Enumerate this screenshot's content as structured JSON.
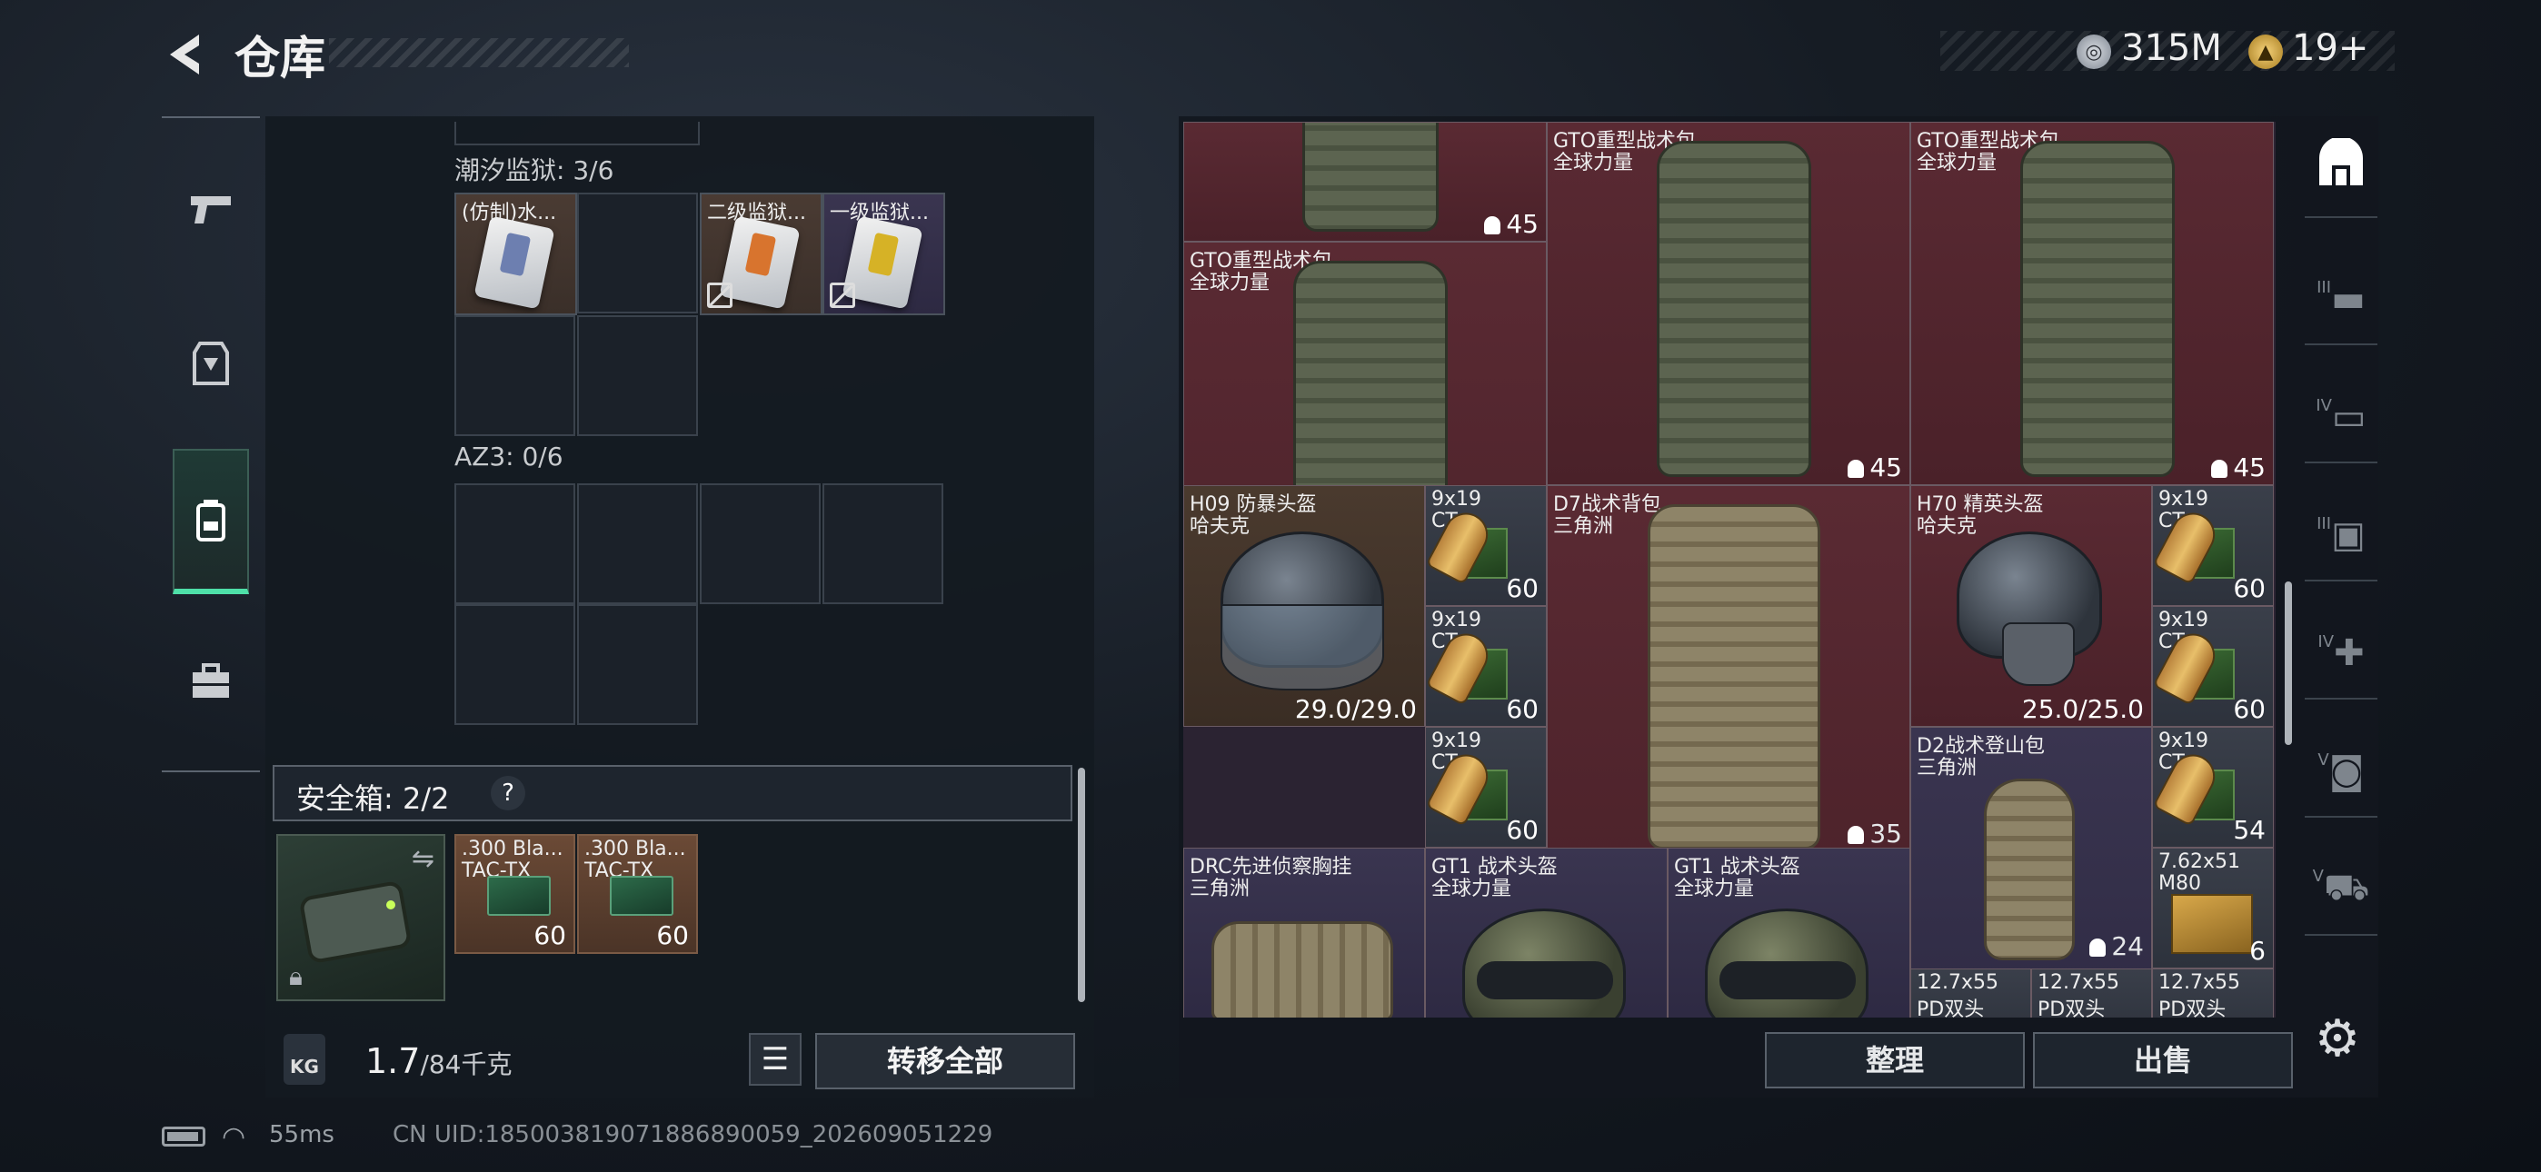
{
  "header": {
    "title": "仓库",
    "currency": [
      {
        "icon": "silver-coin-icon",
        "value": "315M"
      },
      {
        "icon": "gold-token-icon",
        "value": "19+"
      }
    ]
  },
  "left_sidebar": {
    "tabs": [
      {
        "icon": "pistol-icon",
        "active": false
      },
      {
        "icon": "armor-vest-icon",
        "active": false
      },
      {
        "icon": "backpack-icon",
        "active": true
      },
      {
        "icon": "toolbox-icon",
        "active": false
      }
    ]
  },
  "left_panel": {
    "sections": [
      {
        "label": "潮汐监狱: 3/6"
      },
      {
        "label": "AZ3: 0/6"
      }
    ],
    "keycards": [
      {
        "name": "(仿制)水...",
        "tradeable": true,
        "stripe": "#6d7fb0"
      },
      {
        "name": "二级监狱...",
        "tradeable": false,
        "stripe": "#d8742e"
      },
      {
        "name": "一级监狱...",
        "tradeable": false,
        "stripe": "#d6b226"
      }
    ],
    "safe_box": {
      "label": "安全箱: 2/2",
      "help": "?"
    },
    "safe_items": [
      {
        "name": ".300 Bla...",
        "sub": "TAC-TX",
        "count": "60"
      },
      {
        "name": ".300 Bla...",
        "sub": "TAC-TX",
        "count": "60"
      }
    ],
    "weight": {
      "current": "1.7",
      "max": "/84千克"
    },
    "weight_icon_label": "KG",
    "transfer_all": "转移全部"
  },
  "stash": {
    "items": [
      {
        "name": "",
        "sub": "",
        "capacity": "45",
        "color": "red"
      },
      {
        "name": "GTO重型战术包",
        "sub": "全球力量",
        "capacity": "45",
        "color": "red"
      },
      {
        "name": "GTO重型战术包",
        "sub": "全球力量",
        "capacity": "45",
        "color": "red"
      },
      {
        "name": "GTO重型战术包",
        "sub": "全球力量",
        "capacity": "45",
        "color": "red"
      },
      {
        "name": "D7战术背包",
        "sub": "三角洲",
        "capacity": "35",
        "color": "red"
      },
      {
        "name": "H70 精英头盔",
        "sub": "哈夫克",
        "durability": "25.0/25.0",
        "color": "red"
      },
      {
        "name": "H09 防暴头盔",
        "sub": "哈夫克",
        "durability": "29.0/29.0",
        "color": "brown"
      },
      {
        "name": "D2战术登山包",
        "sub": "三角洲",
        "capacity": "24",
        "color": "purple"
      },
      {
        "name": "DRC先进侦察胸挂",
        "sub": "三角洲",
        "color": "purple"
      },
      {
        "name": "GT1 战术头盔",
        "sub": "全球力量",
        "color": "purple"
      },
      {
        "name": "GT1 战术头盔",
        "sub": "全球力量",
        "color": "purple"
      }
    ],
    "ammo": [
      {
        "name": "9x19",
        "sub": "CT",
        "count": "60"
      },
      {
        "name": "9x19",
        "sub": "CT",
        "count": "60"
      },
      {
        "name": "9x19",
        "sub": "CT",
        "count": "60"
      },
      {
        "name": "9x19",
        "sub": "CT",
        "count": "60"
      },
      {
        "name": "9x19",
        "sub": "CT",
        "count": "60"
      },
      {
        "name": "9x19",
        "sub": "CT",
        "count": "54"
      },
      {
        "name": "7.62x51",
        "sub": "M80",
        "count": "6"
      },
      {
        "name": "12.7x55",
        "sub": "PD双头",
        "count": ""
      },
      {
        "name": "12.7x55",
        "sub": "PD双头",
        "count": ""
      },
      {
        "name": "12.7x55",
        "sub": "PD双头",
        "count": ""
      }
    ],
    "sort": "整理",
    "sell": "出售"
  },
  "right_sidebar": {
    "tabs": [
      {
        "icon": "all-items-icon",
        "active": true
      },
      {
        "icon": "III-weapon-icon",
        "active": false
      },
      {
        "icon": "IV-folder-icon",
        "active": false
      },
      {
        "icon": "III-armor-icon",
        "active": false
      },
      {
        "icon": "IV-medkit-icon",
        "active": false
      },
      {
        "icon": "V-gear-icon",
        "active": false
      },
      {
        "icon": "V-vehicle-icon",
        "active": false
      }
    ],
    "roman_labels": [
      "III",
      "IV",
      "III",
      "IV",
      "V",
      "V"
    ]
  },
  "status_bar": {
    "ping": "55ms",
    "uid": "CN UID:18500381907188689005​9_202609051229"
  }
}
